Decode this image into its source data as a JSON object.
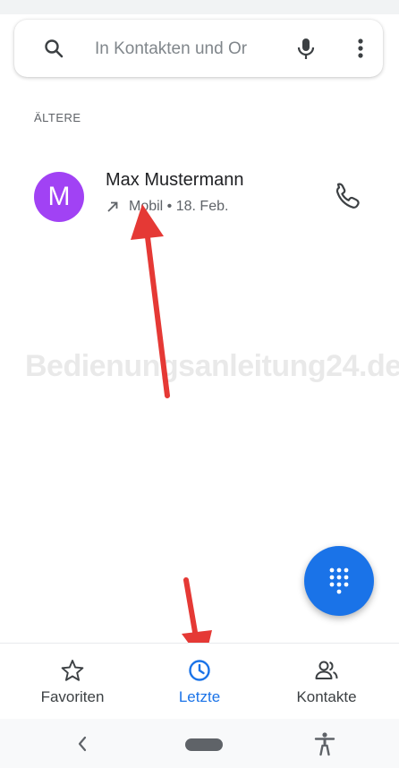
{
  "search": {
    "placeholder": "In Kontakten und Or"
  },
  "recents": {
    "section_header": "ÄLTERE",
    "calls": [
      {
        "avatar_letter": "M",
        "avatar_color": "#a142f4",
        "name": "Max Mustermann",
        "direction_icon": "outgoing-call-arrow-icon",
        "details": "Mobil • 18. Feb."
      }
    ]
  },
  "watermark": "Bedienungsanleitung24.de",
  "nav": {
    "items": [
      {
        "label": "Favoriten",
        "icon": "star-outline-icon",
        "active": false
      },
      {
        "label": "Letzte",
        "icon": "clock-icon",
        "active": true
      },
      {
        "label": "Kontakte",
        "icon": "people-icon",
        "active": false
      }
    ]
  },
  "colors": {
    "accent": "#1a73e8",
    "annotation_arrow": "#e53935",
    "avatar": "#a142f4"
  }
}
